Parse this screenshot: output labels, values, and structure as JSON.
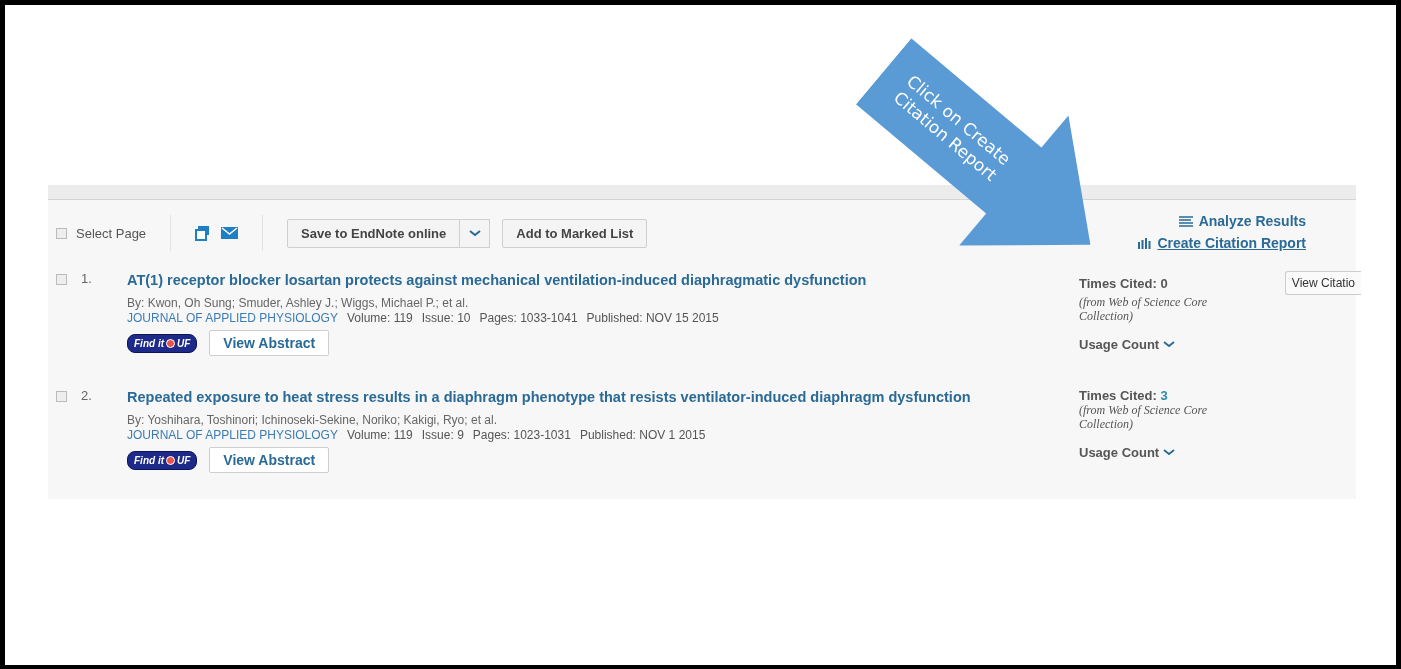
{
  "annotation": {
    "text": "Click on Create Citation Report"
  },
  "toolbar": {
    "select_page": {
      "label": "Select Page",
      "checked": false
    },
    "save_button": "Save to EndNote online",
    "marked_list_button": "Add to Marked List"
  },
  "side_links": {
    "analyze": "Analyze Results",
    "citation_report": "Create Citation Report"
  },
  "records": [
    {
      "number": "1.",
      "checked": false,
      "title": "AT(1) receptor blocker losartan protects against mechanical ventilation-induced diaphragmatic dysfunction",
      "authors": "By: Kwon, Oh Sung; Smuder, Ashley J.; Wiggs, Michael P.; et al.",
      "journal": "JOURNAL OF APPLIED PHYSIOLOGY",
      "details": [
        "Volume: 119",
        "Issue: 10",
        "Pages: 1033-1041",
        "Published: NOV 15 2015"
      ],
      "badge": {
        "left": "Find it",
        "right": "UF"
      },
      "abstract_button": "View Abstract",
      "times_cited_label": "Times Cited:",
      "times_cited": "0",
      "times_cited_linked": false,
      "source": "(from Web of Science Core Collection)",
      "usage": "Usage Count",
      "citation_button": "View Citatio"
    },
    {
      "number": "2.",
      "checked": false,
      "title": "Repeated exposure to heat stress results in a diaphragm phenotype that resists ventilator-induced diaphragm dysfunction",
      "authors": "By: Yoshihara, Toshinori; Ichinoseki-Sekine, Noriko; Kakigi, Ryo; et al.",
      "journal": "JOURNAL OF APPLIED PHYSIOLOGY",
      "details": [
        "Volume: 119",
        "Issue: 9",
        "Pages: 1023-1031",
        "Published: NOV 1 2015"
      ],
      "badge": {
        "left": "Find it",
        "right": "UF"
      },
      "abstract_button": "View Abstract",
      "times_cited_label": "Times Cited:",
      "times_cited": "3",
      "times_cited_linked": true,
      "source": "(from Web of Science Core Collection)",
      "usage": "Usage Count"
    }
  ]
}
